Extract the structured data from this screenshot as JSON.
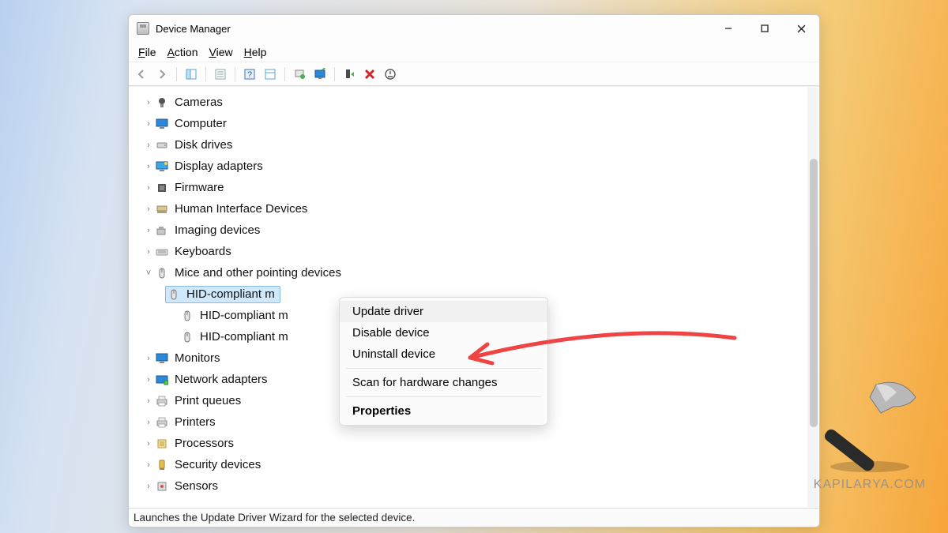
{
  "window": {
    "title": "Device Manager"
  },
  "controls": {
    "min": "Minimize",
    "max": "Maximize",
    "close": "Close"
  },
  "menu": {
    "file": {
      "pre": "F",
      "rest": "ile"
    },
    "action": {
      "pre": "A",
      "rest": "ction"
    },
    "view": {
      "pre": "V",
      "rest": "iew"
    },
    "help": {
      "pre": "H",
      "rest": "elp"
    }
  },
  "toolbar": {
    "back": "Back",
    "forward": "Forward"
  },
  "tree": {
    "categories": [
      {
        "icon": "camera",
        "label": "Cameras",
        "expanded": false
      },
      {
        "icon": "monitor",
        "label": "Computer",
        "expanded": false
      },
      {
        "icon": "disk",
        "label": "Disk drives",
        "expanded": false
      },
      {
        "icon": "display",
        "label": "Display adapters",
        "expanded": false
      },
      {
        "icon": "firmware",
        "label": "Firmware",
        "expanded": false
      },
      {
        "icon": "hid",
        "label": "Human Interface Devices",
        "expanded": false
      },
      {
        "icon": "imaging",
        "label": "Imaging devices",
        "expanded": false
      },
      {
        "icon": "keyboard",
        "label": "Keyboards",
        "expanded": false
      },
      {
        "icon": "mouse",
        "label": "Mice and other pointing devices",
        "expanded": true,
        "children": [
          {
            "icon": "mouse",
            "label": "HID-compliant mouse",
            "selected": true,
            "truncated": "HID-compliant m"
          },
          {
            "icon": "mouse",
            "label": "HID-compliant mouse",
            "truncated": "HID-compliant m"
          },
          {
            "icon": "mouse",
            "label": "HID-compliant mouse",
            "truncated": "HID-compliant m"
          }
        ]
      },
      {
        "icon": "monitor",
        "label": "Monitors",
        "expanded": false
      },
      {
        "icon": "network",
        "label": "Network adapters",
        "expanded": false
      },
      {
        "icon": "printer",
        "label": "Print queues",
        "expanded": false
      },
      {
        "icon": "printer",
        "label": "Printers",
        "expanded": false
      },
      {
        "icon": "cpu",
        "label": "Processors",
        "expanded": false
      },
      {
        "icon": "security",
        "label": "Security devices",
        "expanded": false
      },
      {
        "icon": "sensor",
        "label": "Sensors",
        "expanded": false
      }
    ]
  },
  "context_menu": {
    "items": [
      {
        "label": "Update driver",
        "hover": true
      },
      {
        "label": "Disable device"
      },
      {
        "label": "Uninstall device"
      },
      {
        "sep": true
      },
      {
        "label": "Scan for hardware changes"
      },
      {
        "sep": true
      },
      {
        "label": "Properties",
        "bold": true
      }
    ]
  },
  "statusbar": "Launches the Update Driver Wizard for the selected device.",
  "watermark": "KAPILARYA.COM"
}
